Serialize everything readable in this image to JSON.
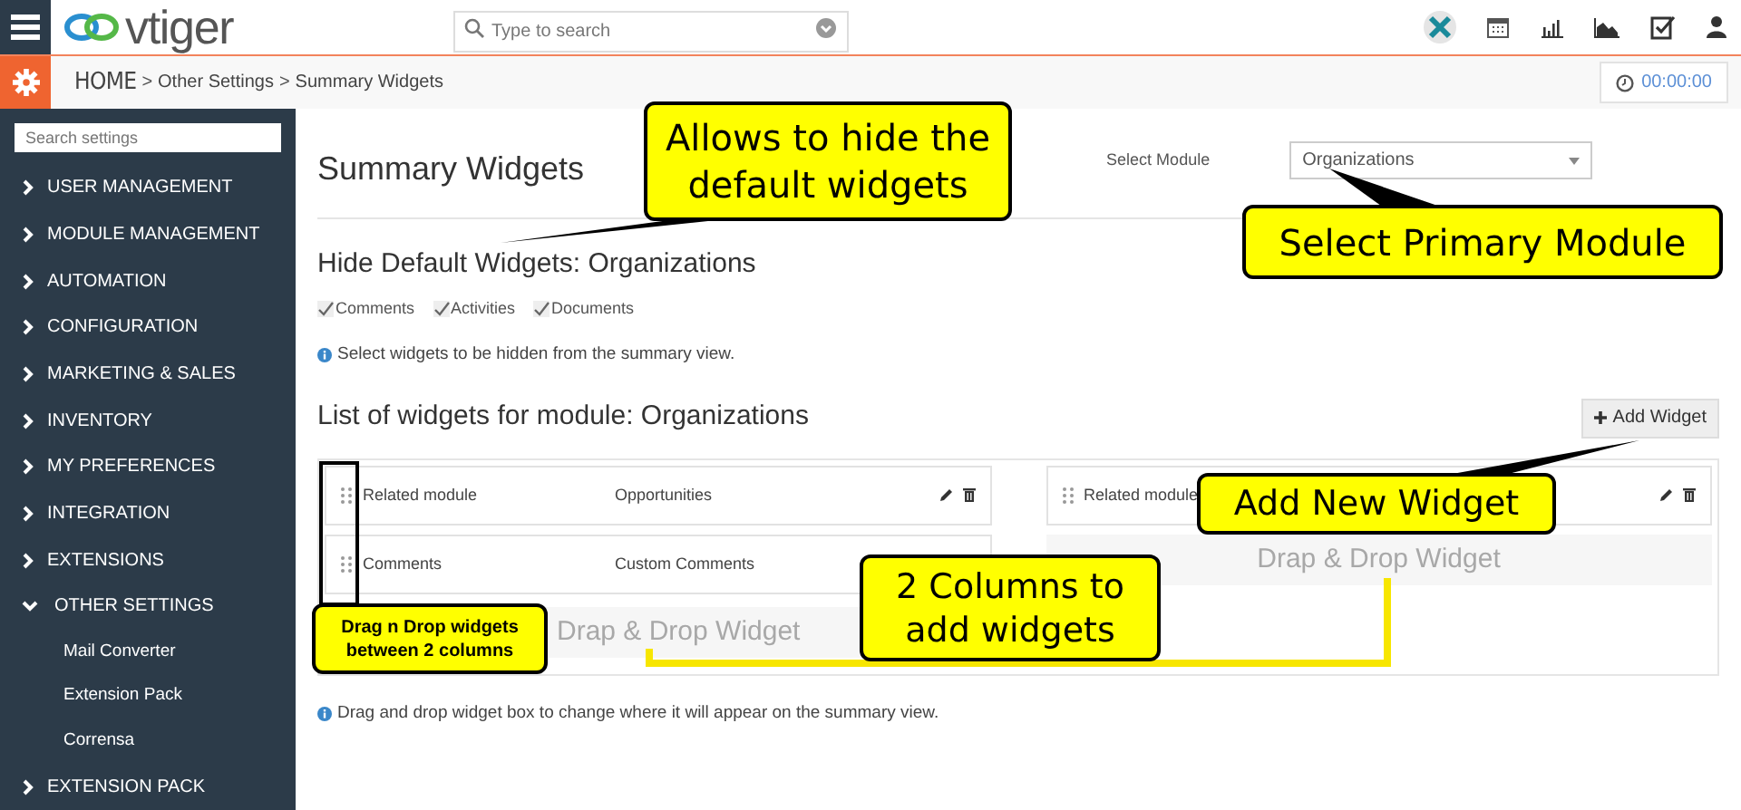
{
  "header": {
    "logo_text": "vtiger",
    "search": {
      "placeholder": "Type to search"
    }
  },
  "breadcrumb": {
    "items": [
      "HOME",
      "Other Settings",
      "Summary Widgets"
    ],
    "separator": ">"
  },
  "timer": "00:00:00",
  "sidebar": {
    "search_placeholder": "Search settings",
    "items": [
      {
        "label": "USER MANAGEMENT",
        "expanded": false
      },
      {
        "label": "MODULE MANAGEMENT",
        "expanded": false
      },
      {
        "label": "AUTOMATION",
        "expanded": false
      },
      {
        "label": "CONFIGURATION",
        "expanded": false
      },
      {
        "label": "MARKETING & SALES",
        "expanded": false
      },
      {
        "label": "INVENTORY",
        "expanded": false
      },
      {
        "label": "MY PREFERENCES",
        "expanded": false
      },
      {
        "label": "INTEGRATION",
        "expanded": false
      },
      {
        "label": "EXTENSIONS",
        "expanded": false
      },
      {
        "label": "OTHER SETTINGS",
        "expanded": true,
        "children": [
          {
            "label": "Mail Converter"
          },
          {
            "label": "Extension Pack"
          },
          {
            "label": "Corrensa"
          }
        ]
      },
      {
        "label": "EXTENSION PACK",
        "expanded": false
      }
    ]
  },
  "page_title": "Summary Widgets",
  "module_select": {
    "label": "Select Module",
    "value": "Organizations"
  },
  "hide_section": {
    "title": "Hide Default Widgets: Organizations",
    "options": [
      {
        "label": "Comments",
        "checked": true
      },
      {
        "label": "Activities",
        "checked": true
      },
      {
        "label": "Documents",
        "checked": true
      }
    ],
    "info": "Select widgets to be hidden from the summary view."
  },
  "list_section": {
    "title": "List of widgets for module: Organizations",
    "add_button": "Add Widget",
    "columns": [
      {
        "widgets": [
          {
            "label": "Related module",
            "value": "Opportunities",
            "actions": true
          },
          {
            "label": "Comments",
            "value": "Custom Comments"
          }
        ],
        "drop_zone": "Drap & Drop Widget"
      },
      {
        "widgets": [
          {
            "label": "Related module",
            "actions": true
          }
        ],
        "drop_zone": "Drap & Drop Widget"
      }
    ],
    "info": "Drag and drop widget box to change where it will appear on the summary view."
  },
  "annotations": [
    {
      "kind": "hide",
      "text": "Allows to hide the default widgets"
    },
    {
      "kind": "module",
      "text": "Select Primary Module"
    },
    {
      "kind": "add",
      "text": "Add New Widget"
    },
    {
      "kind": "drag",
      "text": "Drag n Drop widgets between 2 columns"
    },
    {
      "kind": "columns",
      "text": "2 Columns to add widgets"
    }
  ]
}
